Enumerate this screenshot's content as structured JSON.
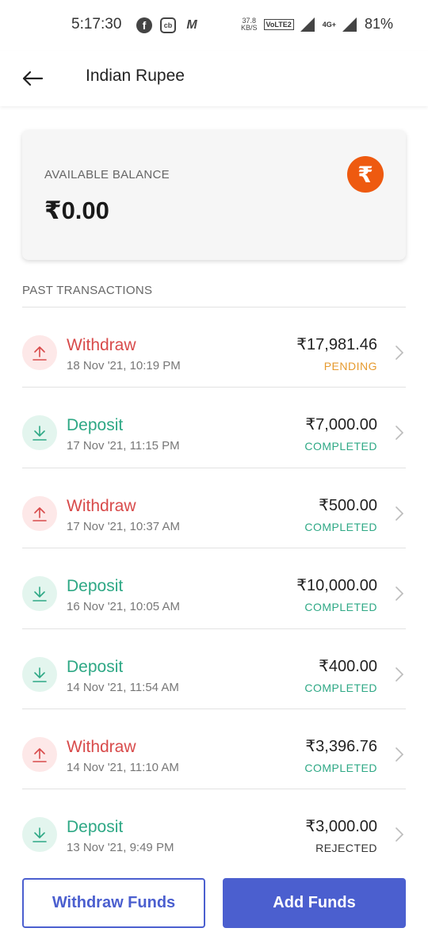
{
  "status_bar": {
    "time": "5:17:30",
    "net_speed_value": "37.8",
    "net_speed_unit": "KB/S",
    "volte_label": "Vo\nLTE2",
    "network_label": "4G+",
    "battery": "81%"
  },
  "header": {
    "title": "Indian Rupee"
  },
  "balance": {
    "label": "AVAILABLE BALANCE",
    "value": "₹0.00",
    "currency_symbol": "₹",
    "badge_color": "#ee5a10"
  },
  "transactions_section": {
    "title": "PAST TRANSACTIONS"
  },
  "transactions": [
    {
      "type": "Withdraw",
      "date": "18 Nov '21, 10:19 PM",
      "amount": "₹17,981.46",
      "status": "PENDING"
    },
    {
      "type": "Deposit",
      "date": "17 Nov '21, 11:15 PM",
      "amount": "₹7,000.00",
      "status": "COMPLETED"
    },
    {
      "type": "Withdraw",
      "date": "17 Nov '21, 10:37 AM",
      "amount": "₹500.00",
      "status": "COMPLETED"
    },
    {
      "type": "Deposit",
      "date": "16 Nov '21, 10:05 AM",
      "amount": "₹10,000.00",
      "status": "COMPLETED"
    },
    {
      "type": "Deposit",
      "date": "14 Nov '21, 11:54 AM",
      "amount": "₹400.00",
      "status": "COMPLETED"
    },
    {
      "type": "Withdraw",
      "date": "14 Nov '21, 11:10 AM",
      "amount": "₹3,396.76",
      "status": "COMPLETED"
    },
    {
      "type": "Deposit",
      "date": "13 Nov '21, 9:49 PM",
      "amount": "₹3,000.00",
      "status": "REJECTED"
    }
  ],
  "actions": {
    "withdraw_label": "Withdraw Funds",
    "add_label": "Add Funds"
  },
  "colors": {
    "withdraw": "#d84a4a",
    "deposit": "#2ea885",
    "pending": "#e69a2e",
    "primary": "#4b5fcf"
  }
}
